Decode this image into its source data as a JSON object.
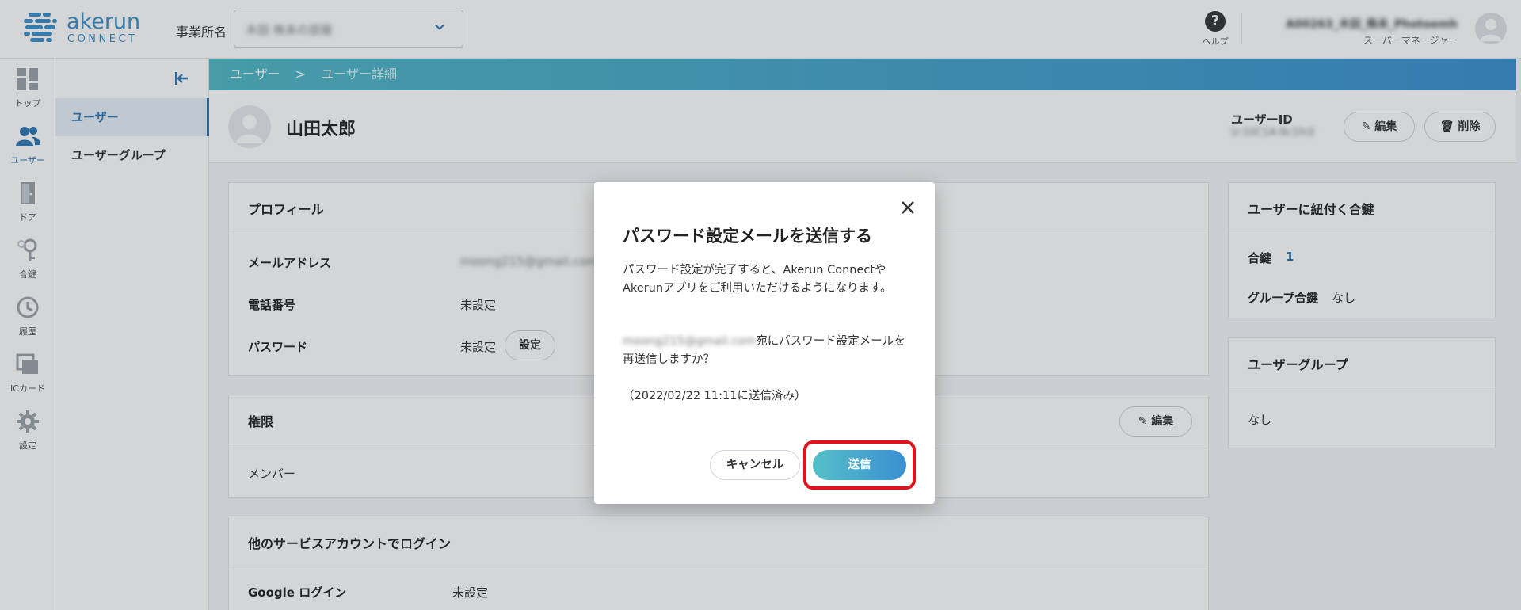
{
  "header": {
    "logo_word": "akerun",
    "logo_sub": "CONNECT",
    "office_label": "事業所名",
    "office_value": "木田 株未の部屋",
    "help_label": "ヘルプ",
    "user_name": "A00263_木田_株未_Photoemh",
    "user_role": "スーパーマネージャー"
  },
  "iconnav": [
    {
      "label": "トップ",
      "icon": "dashboard-icon"
    },
    {
      "label": "ユーザー",
      "icon": "users-icon",
      "active": true
    },
    {
      "label": "ドア",
      "icon": "door-icon"
    },
    {
      "label": "合鍵",
      "icon": "key-icon"
    },
    {
      "label": "履歴",
      "icon": "history-icon"
    },
    {
      "label": "ICカード",
      "icon": "ic-card-icon"
    },
    {
      "label": "設定",
      "icon": "gear-icon"
    }
  ],
  "subnav": [
    {
      "label": "ユーザー",
      "active": true
    },
    {
      "label": "ユーザーグループ"
    }
  ],
  "breadcrumb": {
    "root": "ユーザー",
    "sep": ">",
    "current": "ユーザー詳細"
  },
  "user": {
    "name": "山田太郎",
    "id_label": "ユーザーID",
    "id_value": "U-10C1A-8c1fc0",
    "edit_label": "編集",
    "delete_label": "削除"
  },
  "profile": {
    "title": "プロフィール",
    "email_label": "メールアドレス",
    "email_value": "moong215@gmail.com",
    "phone_label": "電話番号",
    "phone_value": "未設定",
    "password_label": "パスワード",
    "password_value": "未設定",
    "password_set_button": "設定"
  },
  "permission": {
    "title": "権限",
    "edit_label": "編集",
    "value": "メンバー"
  },
  "oauth": {
    "title": "他のサービスアカウントでログイン",
    "google_label": "Google ログイン",
    "google_value": "未設定"
  },
  "keys_card": {
    "title": "ユーザーに紐付く合鍵",
    "key_label": "合鍵",
    "key_count": "1",
    "group_key_label": "グループ合鍵",
    "group_key_value": "なし"
  },
  "groups_card": {
    "title": "ユーザーグループ",
    "value": "なし"
  },
  "modal": {
    "title": "パスワード設定メールを送信する",
    "p1": "パスワード設定が完了すると、Akerun ConnectやAkerunアプリをご利用いただけるようになります。",
    "p2_email": "moong215@gmail.com",
    "p2_rest": "宛にパスワード設定メールを再送信しますか？",
    "p3": "（2022/02/22 11:11に送信済み）",
    "cancel_label": "キャンセル",
    "send_label": "送信"
  },
  "colors": {
    "accent": "#2f77b5",
    "gradient_start": "#4fb8c6",
    "gradient_end": "#3a8fd0",
    "highlight": "#e0141e"
  }
}
